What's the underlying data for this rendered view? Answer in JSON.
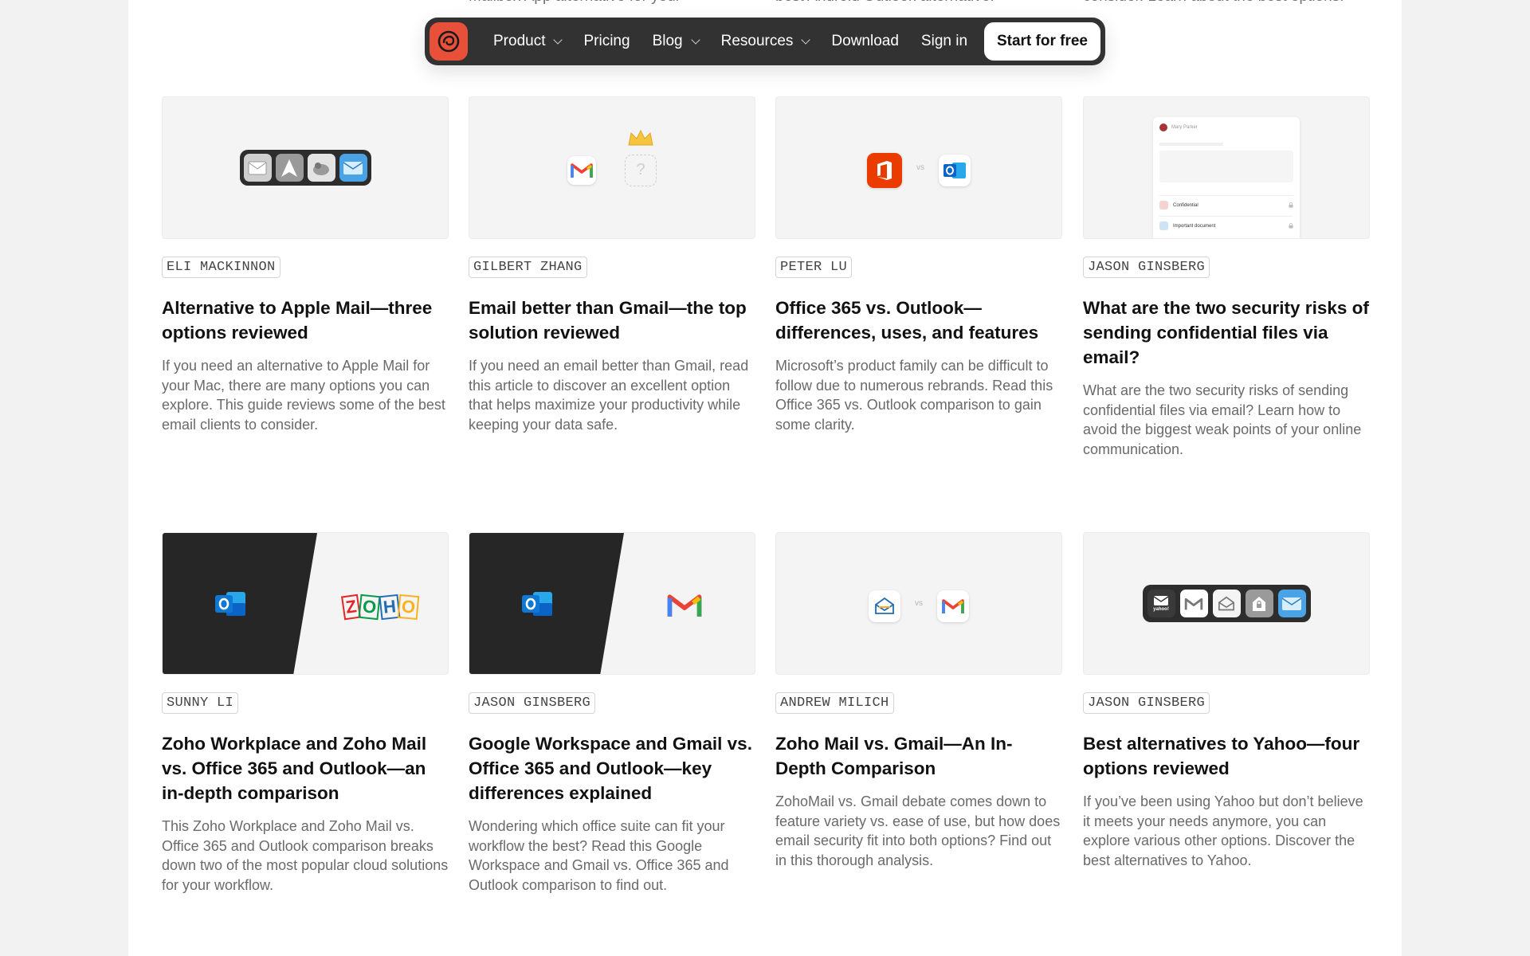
{
  "top_fragments": [
    "Mailbox App alternative for your",
    "best Android Outlook alternative.",
    "consider. Learn about the best options."
  ],
  "nav": {
    "logo_icon": "spike-logo-icon",
    "items": [
      {
        "label": "Product",
        "dropdown": true
      },
      {
        "label": "Pricing",
        "dropdown": false
      },
      {
        "label": "Blog",
        "dropdown": true
      },
      {
        "label": "Resources",
        "dropdown": true
      },
      {
        "label": "Download",
        "dropdown": false
      },
      {
        "label": "Sign in",
        "dropdown": false
      }
    ],
    "cta_label": "Start for free"
  },
  "thumbs": {
    "vs": "vs",
    "zoho": "ZOHO",
    "question": "?",
    "preview_name": "Mary Parker",
    "preview_file1": "Confidential",
    "preview_file2": "Important document",
    "yahoo": "yahoo!"
  },
  "articles": [
    {
      "author": "ELI MACKINNON",
      "title": "Alternative to Apple Mail—three options reviewed",
      "description": "If you need an alternative to Apple Mail for your Mac, there are many options you can explore. This guide reviews some of the best email clients to consider."
    },
    {
      "author": "GILBERT ZHANG",
      "title": "Email better than Gmail—the top solution reviewed",
      "description": "If you need an email better than Gmail, read this article to discover an excellent option that helps maximize your productivity while keeping your data safe."
    },
    {
      "author": "PETER LU",
      "title": "Office 365 vs. Outlook—differences, uses, and features",
      "description": "Microsoft’s product family can be difficult to follow due to numerous rebrands. Read this Office 365 vs. Outlook comparison to gain some clarity."
    },
    {
      "author": "JASON GINSBERG",
      "title": "What are the two security risks of sending confidential files via email?",
      "description": "What are the two security risks of sending confidential files via email? Learn how to avoid the biggest weak points of your online communication."
    },
    {
      "author": "SUNNY LI",
      "title": "Zoho Workplace and Zoho Mail vs. Office 365 and Outlook—an in-depth comparison",
      "description": "This Zoho Workplace and Zoho Mail vs. Office 365 and Outlook comparison breaks down two of the most popular cloud solutions for your workflow."
    },
    {
      "author": "JASON GINSBERG",
      "title": "Google Workspace and Gmail vs. Office 365 and Outlook—key differences explained",
      "description": "Wondering which office suite can fit your workflow the best? Read this Google Workspace and Gmail vs. Office 365 and Outlook comparison to find out."
    },
    {
      "author": "ANDREW MILICH",
      "title": "Zoho Mail vs. Gmail—An In-Depth Comparison",
      "description": "ZohoMail vs. Gmail debate comes down to feature variety vs. ease of use, but how does email security fit into both options? Find out in this thorough analysis."
    },
    {
      "author": "JASON GINSBERG",
      "title": "Best alternatives to Yahoo—four options reviewed",
      "description": "If you’ve been using Yahoo but don’t believe it meets your needs anymore, you can explore various other options. Discover the best alternatives to Yahoo."
    }
  ],
  "colors": {
    "nav_bg": "#323232",
    "logo_bg": "#e8503a",
    "gmail_red": "#ea4335",
    "office_red": "#eb3c00",
    "outlook_blue": "#0a64c8"
  }
}
